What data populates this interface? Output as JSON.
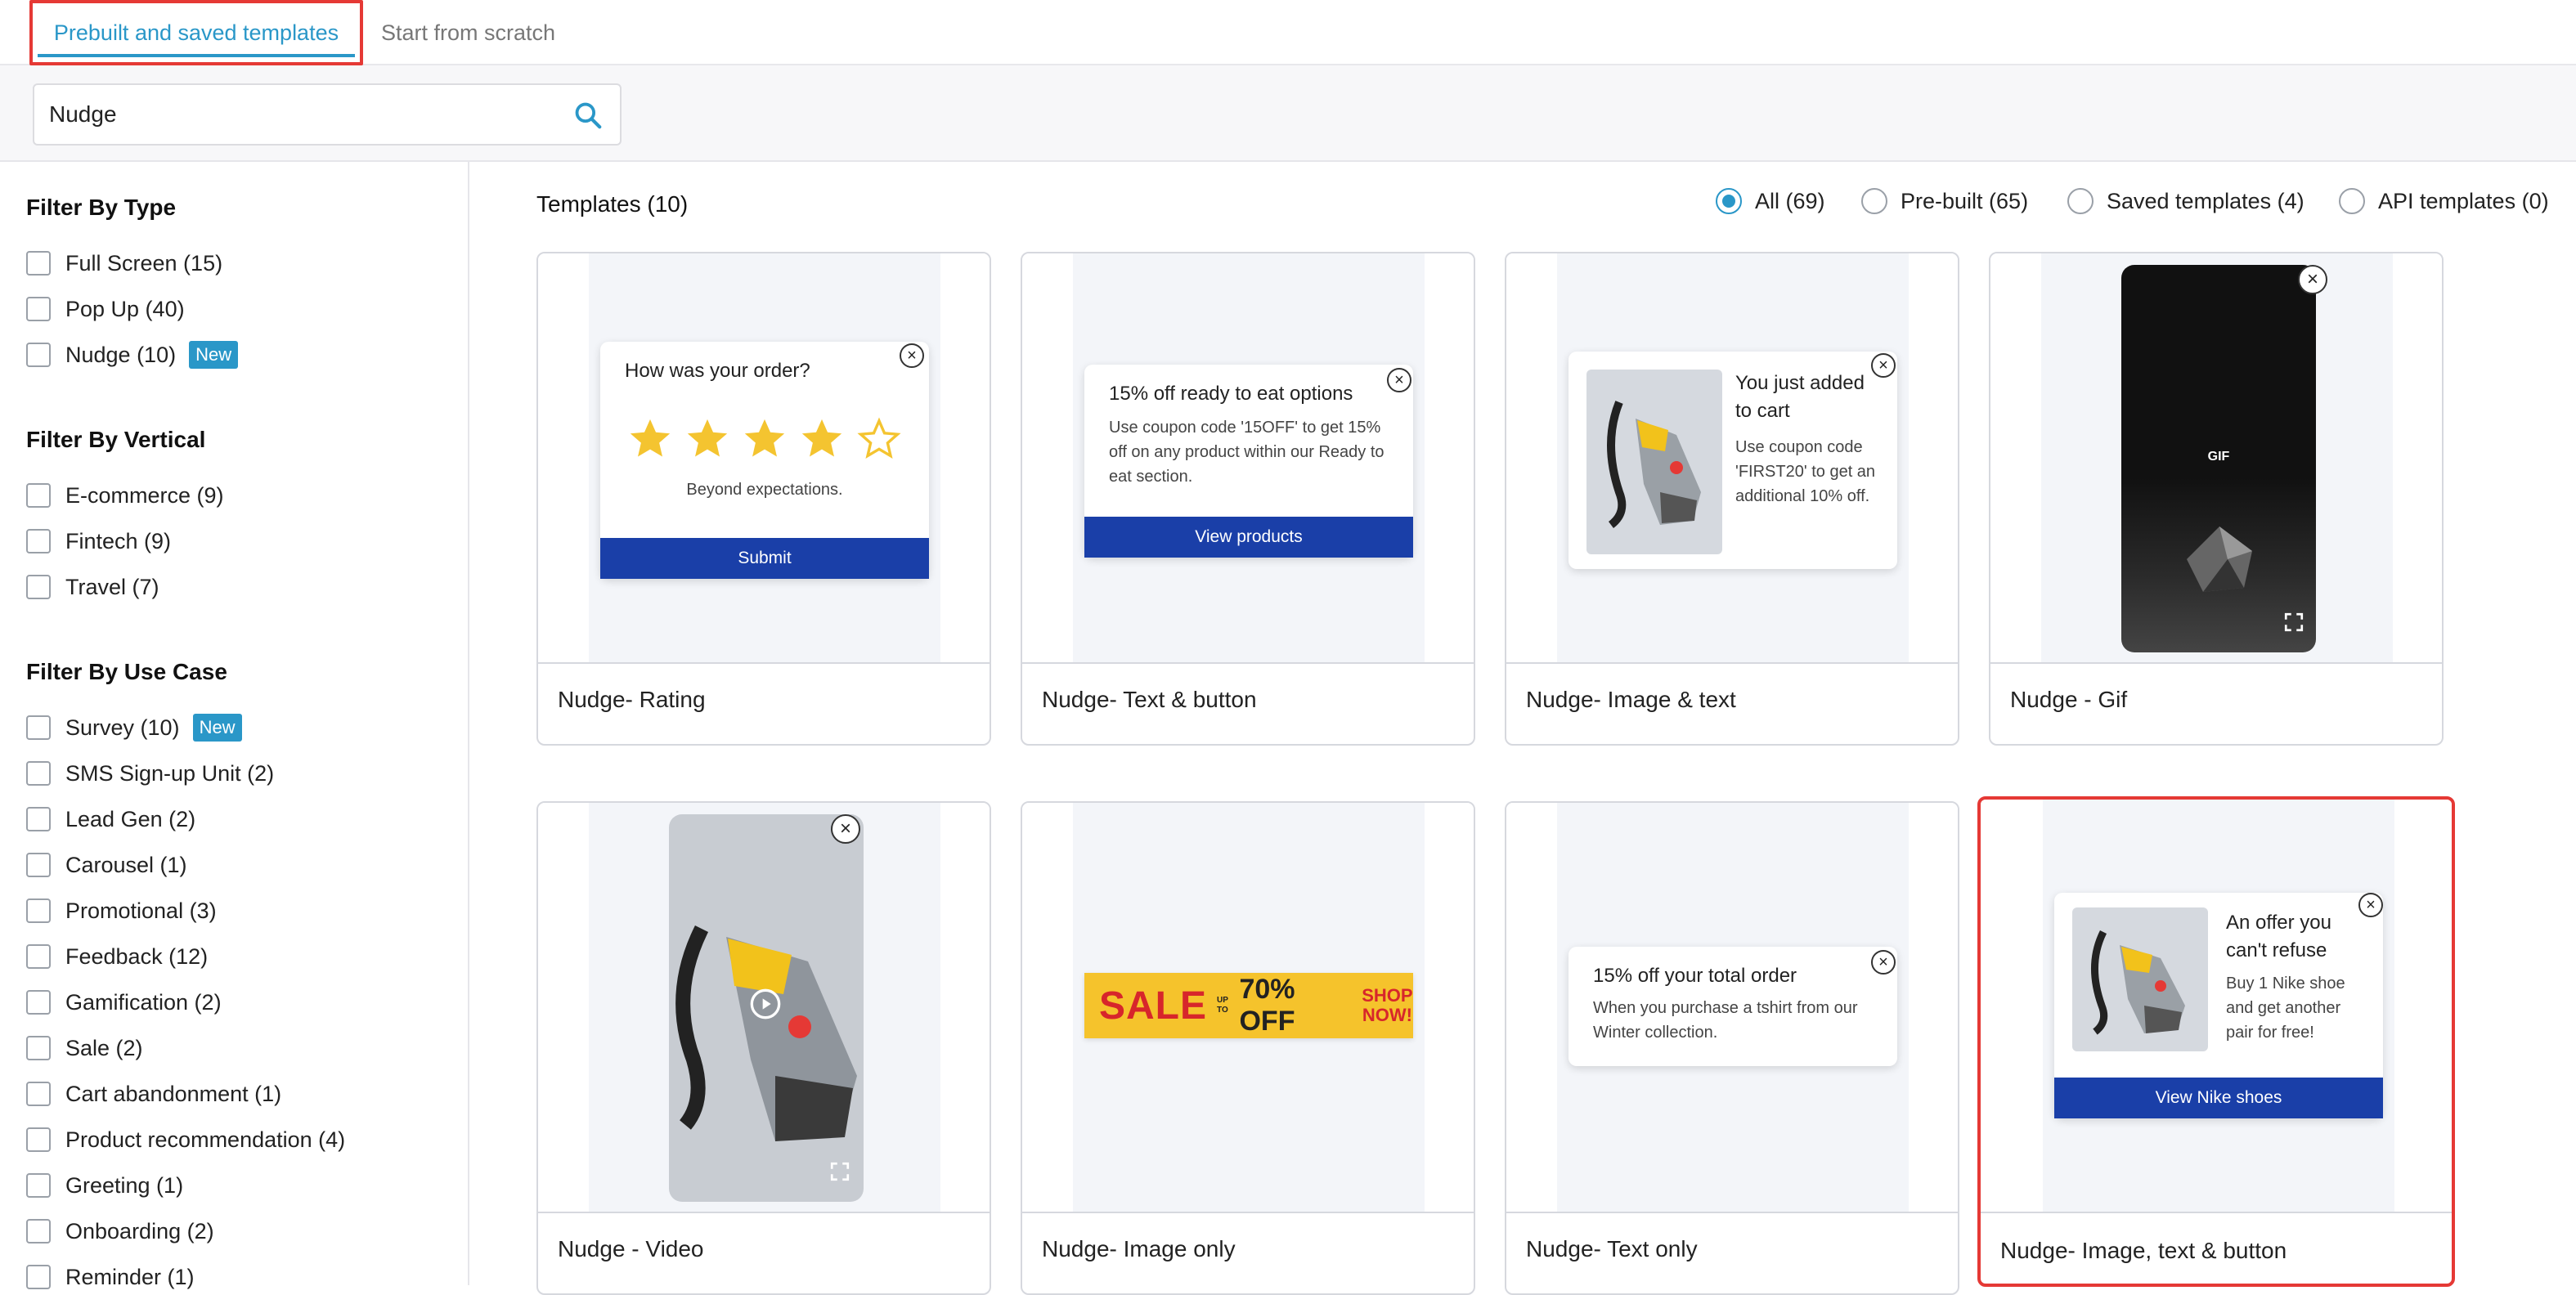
{
  "tabs": {
    "active": "Prebuilt and saved templates",
    "other": "Start from scratch"
  },
  "search": {
    "value": "Nudge"
  },
  "filters": {
    "type_heading": "Filter By Type",
    "type_items": [
      {
        "label": "Full Screen (15)"
      },
      {
        "label": "Pop Up (40)"
      },
      {
        "label": "Nudge (10)",
        "badge": "New"
      }
    ],
    "vertical_heading": "Filter By Vertical",
    "vertical_items": [
      {
        "label": "E-commerce (9)"
      },
      {
        "label": "Fintech (9)"
      },
      {
        "label": "Travel (7)"
      }
    ],
    "usecase_heading": "Filter By Use Case",
    "usecase_items": [
      {
        "label": "Survey (10)",
        "badge": "New"
      },
      {
        "label": "SMS Sign-up Unit (2)"
      },
      {
        "label": "Lead Gen (2)"
      },
      {
        "label": "Carousel (1)"
      },
      {
        "label": "Promotional (3)"
      },
      {
        "label": "Feedback (12)"
      },
      {
        "label": "Gamification (2)"
      },
      {
        "label": "Sale (2)"
      },
      {
        "label": "Cart abandonment (1)"
      },
      {
        "label": "Product recommendation (4)"
      },
      {
        "label": "Greeting (1)"
      },
      {
        "label": "Onboarding (2)"
      },
      {
        "label": "Reminder (1)"
      }
    ]
  },
  "main": {
    "title": "Templates (10)",
    "radios": [
      {
        "label": "All (69)",
        "selected": true
      },
      {
        "label": "Pre-built (65)",
        "selected": false
      },
      {
        "label": "Saved templates (4)",
        "selected": false
      },
      {
        "label": "API templates (0)",
        "selected": false
      }
    ]
  },
  "cards": [
    {
      "label": "Nudge- Rating",
      "popup_title": "How was your order?",
      "caption": "Beyond expectations.",
      "button": "Submit",
      "rating": 4,
      "rating_max": 5
    },
    {
      "label": "Nudge- Text & button",
      "popup_title": "15% off ready to eat options",
      "text": "Use coupon code '15OFF' to get 15% off on any product within our Ready to eat section.",
      "button": "View products"
    },
    {
      "label": "Nudge- Image & text",
      "popup_title": "You just added to cart",
      "text": "Use coupon code 'FIRST20' to get an additional 10% off."
    },
    {
      "label": "Nudge - Gif",
      "overlay": "GIF"
    },
    {
      "label": "Nudge - Video"
    },
    {
      "label": "Nudge- Image only",
      "banner_sale": "SALE",
      "banner_upto": "UP TO",
      "banner_off": "70% OFF",
      "banner_shop": "SHOP NOW!"
    },
    {
      "label": "Nudge- Text only",
      "popup_title": "15% off your total order",
      "text": "When you purchase a tshirt from our Winter collection."
    },
    {
      "label": "Nudge- Image, text & button",
      "popup_title": "An offer you can't refuse",
      "text": "Buy 1 Nike shoe and get another pair for free!",
      "button": "View Nike shoes"
    }
  ],
  "colors": {
    "accent": "#2a97c8",
    "highlight": "#e53935",
    "button": "#1a3fa8",
    "star": "#f4c430",
    "banner": "#f5c32c",
    "sale_red": "#d7262b"
  }
}
